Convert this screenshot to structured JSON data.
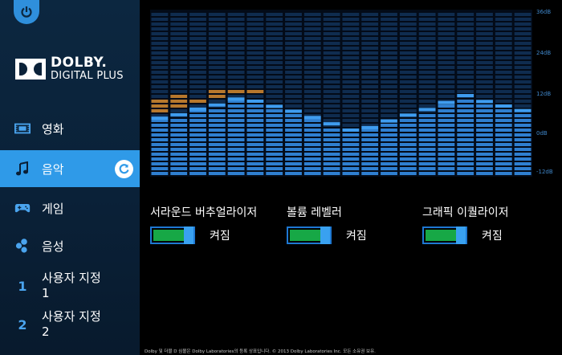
{
  "brand": {
    "word": "DOLBY.",
    "sub": "DIGITAL PLUS"
  },
  "nav": [
    {
      "label": "영화",
      "icon": "film-icon",
      "active": false
    },
    {
      "label": "음악",
      "icon": "music-note-icon",
      "active": true
    },
    {
      "label": "게임",
      "icon": "gamepad-icon",
      "active": false
    },
    {
      "label": "음성",
      "icon": "voice-icon",
      "active": false
    },
    {
      "label": "사용자 지정\n1",
      "icon": "number-1-icon",
      "num": "1",
      "active": false
    },
    {
      "label": "사용자 지정\n2",
      "icon": "number-2-icon",
      "num": "2",
      "active": false
    }
  ],
  "eq": {
    "scale_labels": [
      "36dB",
      "24dB",
      "12dB",
      "0dB",
      "-12dB"
    ],
    "colors": {
      "dim": "#0f2c4f",
      "bright": "#2f7fd0",
      "boost": "#b7782d",
      "marker": "#3f9df0"
    },
    "curve_db": [
      4.8,
      5.8,
      7.4,
      8.6,
      10.3,
      9.7,
      8.2,
      6.8,
      5.0,
      3.2,
      1.4,
      2.1,
      4.0,
      5.7,
      7.3,
      9.3,
      11.3,
      9.6,
      8.3,
      7.0
    ],
    "boost_rows": [
      3,
      3,
      1,
      2,
      1,
      1,
      0,
      0,
      0,
      0,
      0,
      0,
      0,
      0,
      0,
      0,
      0,
      0,
      0,
      0
    ]
  },
  "controls": [
    {
      "title": "서라운드 버추얼라이저",
      "state": "켜짐",
      "on": true
    },
    {
      "title": "볼륨 레벨러",
      "state": "켜짐",
      "on": true
    },
    {
      "title": "그래픽 이퀄라이저",
      "state": "켜짐",
      "on": true
    }
  ],
  "footer": "Dolby 및 더블 D 심볼은 Dolby Laboratories의 등록 상표입니다. © 2013 Dolby Laboratories Inc. 모든 소유권 보유."
}
